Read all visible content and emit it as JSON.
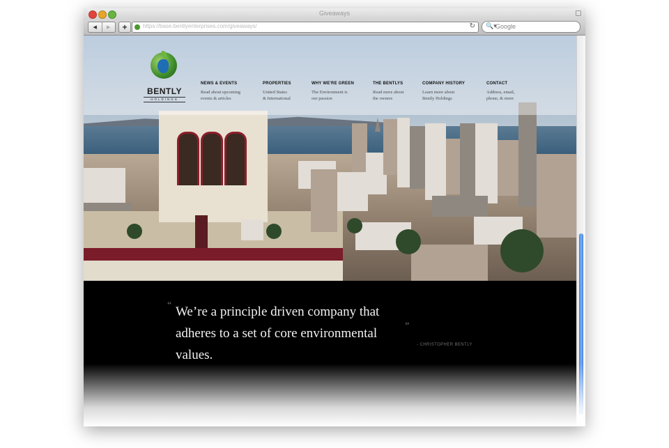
{
  "browser": {
    "title": "Giveaways",
    "url": "https://base.bentlyenterprises.com/giveaways/",
    "search_placeholder": "Google",
    "back_glyph": "◀",
    "forward_glyph": "▶",
    "add_glyph": "+",
    "reload_glyph": "↻",
    "search_glyph": "🔍▾"
  },
  "logo": {
    "name": "BENTLY",
    "sub": "HOLDINGS"
  },
  "nav": {
    "items": [
      {
        "label": "NEWS & EVENTS",
        "desc": "Read about upcoming\nevents & articles"
      },
      {
        "label": "PROPERTIES",
        "desc": "United States\n& International"
      },
      {
        "label": "WHY WE'RE GREEN",
        "desc": "The Environment is\nour passion"
      },
      {
        "label": "THE BENTLYS",
        "desc": "Read more about\nthe owners"
      },
      {
        "label": "COMPANY HISTORY",
        "desc": "Learn more about\nBently Holdings"
      },
      {
        "label": "CONTACT",
        "desc": "Address, email,\nphone, & more"
      }
    ]
  },
  "quote": {
    "open_mark": "“",
    "text": "We’re a principle driven company that adheres to a set of core environmental values.",
    "close_mark": "”",
    "attribution": "- CHRISTOPHER BENTLY"
  },
  "colors": {
    "roof_accent": "#7b1c2a",
    "brand_green": "#3c8a2a",
    "brand_blue": "#1e6db5",
    "quote_background": "#000000",
    "scroll_thumb": "#3b7be0"
  }
}
